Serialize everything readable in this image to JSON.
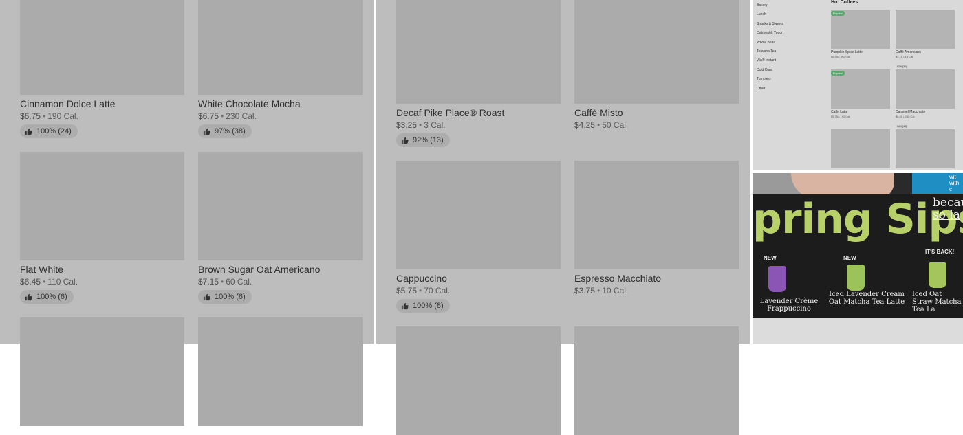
{
  "panel_left": {
    "cards": [
      {
        "name": "Cinnamon Dolce Latte",
        "price": "$6.75",
        "cal": "190 Cal.",
        "rating": "100% (24)"
      },
      {
        "name": "White Chocolate Mocha",
        "price": "$6.75",
        "cal": "230 Cal.",
        "rating": "97% (38)"
      },
      {
        "name": "Flat White",
        "price": "$6.45",
        "cal": "110 Cal.",
        "rating": "100% (6)"
      },
      {
        "name": "Brown Sugar Oat Americano",
        "price": "$7.15",
        "cal": "60 Cal.",
        "rating": "100% (6)"
      }
    ]
  },
  "panel_middle": {
    "cards": [
      {
        "name": "Decaf Pike Place® Roast",
        "price": "$3.25",
        "cal": "3 Cal.",
        "rating": "92% (13)"
      },
      {
        "name": "Caffè Misto",
        "price": "$4.25",
        "cal": "50 Cal.",
        "rating": ""
      },
      {
        "name": "Cappuccino",
        "price": "$5.75",
        "cal": "70 Cal.",
        "rating": "100% (8)"
      },
      {
        "name": "Espresso Macchiato",
        "price": "$3.75",
        "cal": "10 Cal.",
        "rating": ""
      }
    ]
  },
  "menu_panel": {
    "categories": [
      "Bakery",
      "Lunch",
      "Snacks & Sweets",
      "Oatmeal & Yogurt",
      "Whole Bean",
      "Teavana Tea",
      "VIA® Instant",
      "Cold Cups",
      "Tumblers",
      "Other"
    ],
    "section_title": "Hot Coffees",
    "badge": "Popular",
    "items": [
      {
        "name": "Pumpkin Spice Latte",
        "price": "$6.95 • 390 Cal.",
        "rating": ""
      },
      {
        "name": "Caffè Americano",
        "price": "$4.15 • 15 Cal.",
        "rating": "92% (31)"
      },
      {
        "name": "Caffè Latte",
        "price": "$5.75 • 190 Cal.",
        "rating": ""
      },
      {
        "name": "Caramel Macchiato",
        "price": "$6.45 • 250 Cal.",
        "rating": "94% (18)"
      }
    ]
  },
  "photo_panel": {
    "sign_title": "pring Sips",
    "side_line1": "becau",
    "side_line2": "so la",
    "tags": [
      "NEW",
      "NEW",
      "IT'S BACK!"
    ],
    "drinks": [
      "Lavender Crème Frappuccino",
      "Iced Lavender Cream Oat Matcha Tea Latte",
      "Iced Oat Straw Matcha Tea La"
    ],
    "box_text": "wit with c"
  },
  "colors": {
    "badge": "#5aa870",
    "sign_text": "#b8d06a",
    "purple_cup": "#8a55b5",
    "green_cup": "#9cc25a"
  }
}
